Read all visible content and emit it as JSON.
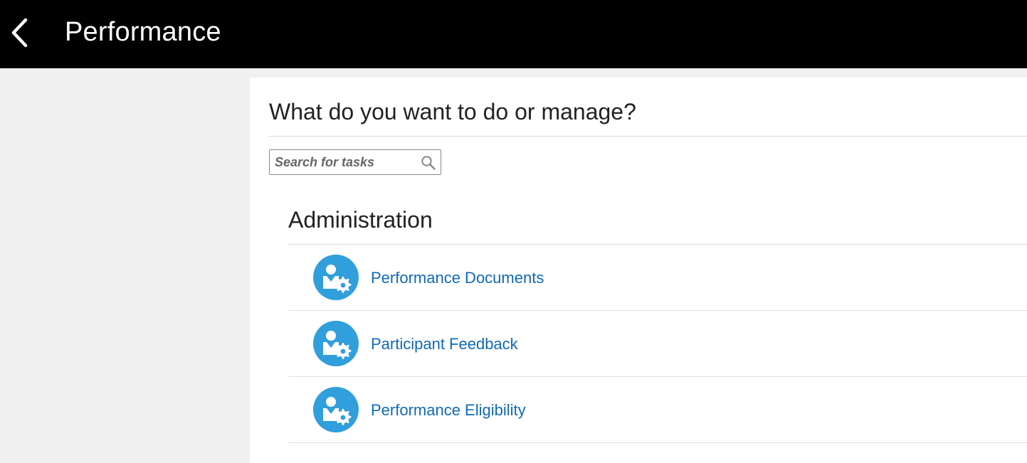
{
  "header": {
    "title": "Performance",
    "back_icon": "chevron-left-icon",
    "background_color": "#000000",
    "text_color": "#ffffff"
  },
  "content": {
    "heading": "What do you want to do or manage?",
    "search": {
      "placeholder": "Search for tasks",
      "value": "",
      "icon": "search-icon"
    },
    "section": {
      "title": "Administration",
      "tasks": [
        {
          "label": "Performance Documents",
          "icon": "user-settings-icon"
        },
        {
          "label": "Participant Feedback",
          "icon": "user-settings-icon"
        },
        {
          "label": "Performance Eligibility",
          "icon": "user-settings-icon"
        }
      ]
    }
  },
  "colors": {
    "accent": "#309fdb",
    "link": "#0f6ab4",
    "page_background": "#f0f0f0",
    "panel_background": "#ffffff"
  }
}
